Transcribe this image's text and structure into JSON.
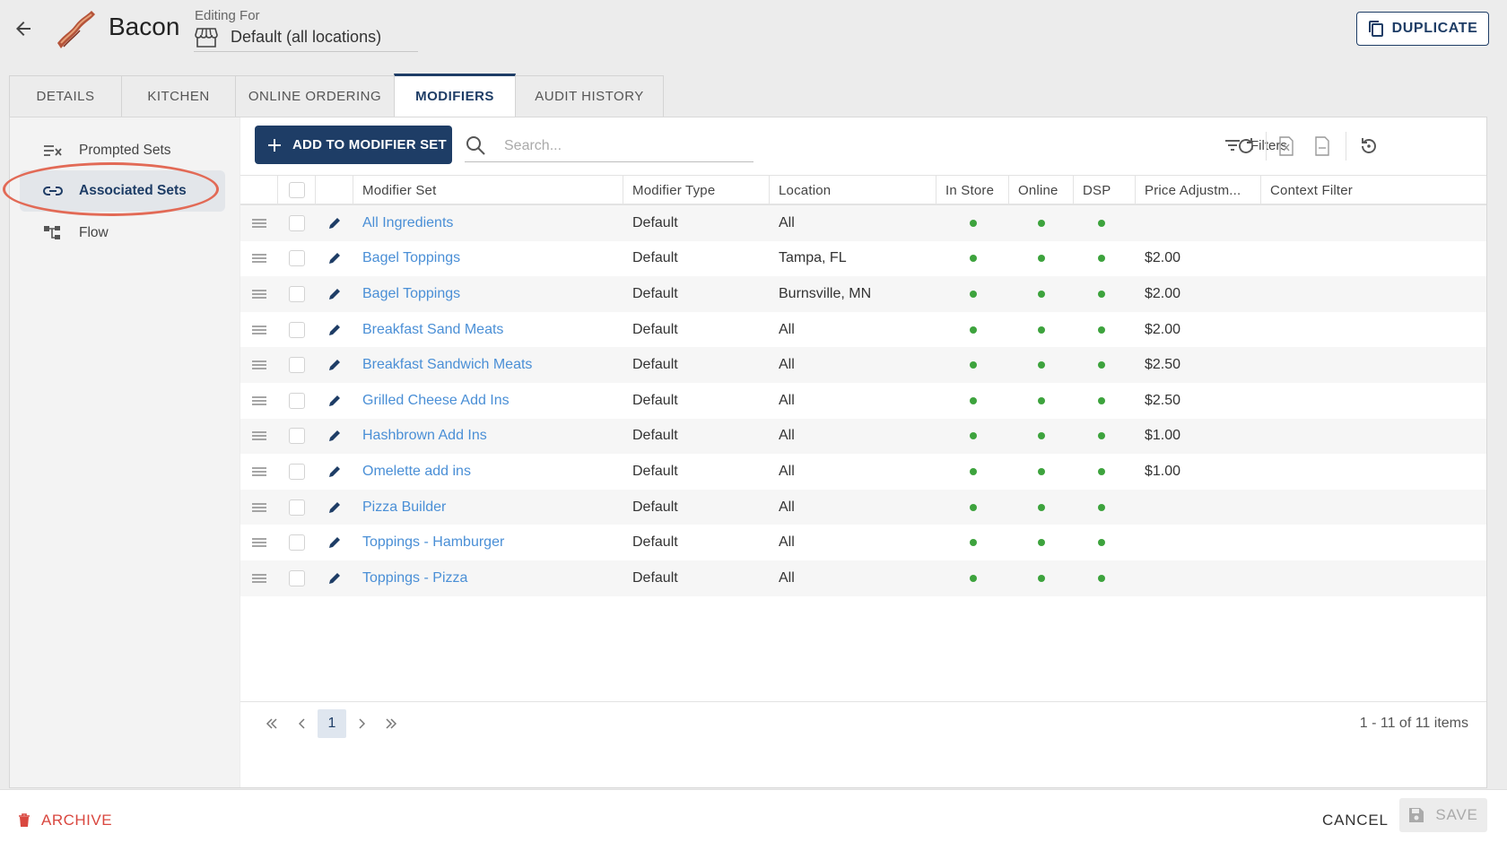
{
  "header": {
    "title": "Bacon",
    "editing_label": "Editing For",
    "editing_value": "Default (all locations)",
    "duplicate_label": "DUPLICATE"
  },
  "tabs": [
    {
      "label": "DETAILS",
      "active": false
    },
    {
      "label": "KITCHEN",
      "active": false
    },
    {
      "label": "ONLINE ORDERING",
      "active": false
    },
    {
      "label": "MODIFIERS",
      "active": true
    },
    {
      "label": "AUDIT HISTORY",
      "active": false
    }
  ],
  "sidebar": {
    "items": [
      {
        "label": "Prompted Sets",
        "icon": "checklist-icon",
        "active": false
      },
      {
        "label": "Associated Sets",
        "icon": "link-icon",
        "active": true
      },
      {
        "label": "Flow",
        "icon": "flow-icon",
        "active": false
      }
    ]
  },
  "toolbar": {
    "add_label": "ADD TO MODIFIER SET",
    "search_placeholder": "Search...",
    "filters_label": "Filters"
  },
  "grid": {
    "columns": [
      "Modifier Set",
      "Modifier Type",
      "Location",
      "In Store",
      "Online",
      "DSP",
      "Price Adjustm...",
      "Context Filter"
    ],
    "rows": [
      {
        "set": "All Ingredients",
        "type": "Default",
        "location": "All",
        "in_store": true,
        "online": true,
        "dsp": true,
        "price": "",
        "context": ""
      },
      {
        "set": "Bagel Toppings",
        "type": "Default",
        "location": "Tampa, FL",
        "in_store": true,
        "online": true,
        "dsp": true,
        "price": "$2.00",
        "context": ""
      },
      {
        "set": "Bagel Toppings",
        "type": "Default",
        "location": "Burnsville, MN",
        "in_store": true,
        "online": true,
        "dsp": true,
        "price": "$2.00",
        "context": ""
      },
      {
        "set": "Breakfast Sand Meats",
        "type": "Default",
        "location": "All",
        "in_store": true,
        "online": true,
        "dsp": true,
        "price": "$2.00",
        "context": ""
      },
      {
        "set": "Breakfast Sandwich Meats",
        "type": "Default",
        "location": "All",
        "in_store": true,
        "online": true,
        "dsp": true,
        "price": "$2.50",
        "context": ""
      },
      {
        "set": "Grilled Cheese Add Ins",
        "type": "Default",
        "location": "All",
        "in_store": true,
        "online": true,
        "dsp": true,
        "price": "$2.50",
        "context": ""
      },
      {
        "set": "Hashbrown Add Ins",
        "type": "Default",
        "location": "All",
        "in_store": true,
        "online": true,
        "dsp": true,
        "price": "$1.00",
        "context": ""
      },
      {
        "set": "Omelette add ins",
        "type": "Default",
        "location": "All",
        "in_store": true,
        "online": true,
        "dsp": true,
        "price": "$1.00",
        "context": ""
      },
      {
        "set": "Pizza Builder",
        "type": "Default",
        "location": "All",
        "in_store": true,
        "online": true,
        "dsp": true,
        "price": "",
        "context": ""
      },
      {
        "set": "Toppings - Hamburger",
        "type": "Default",
        "location": "All",
        "in_store": true,
        "online": true,
        "dsp": true,
        "price": "",
        "context": ""
      },
      {
        "set": "Toppings - Pizza",
        "type": "Default",
        "location": "All",
        "in_store": true,
        "online": true,
        "dsp": true,
        "price": "",
        "context": ""
      }
    ]
  },
  "pager": {
    "current_page": "1",
    "info": "1 - 11 of 11 items"
  },
  "footer": {
    "archive_label": "ARCHIVE",
    "cancel_label": "CANCEL",
    "save_label": "SAVE"
  },
  "colors": {
    "primary": "#1e3d66",
    "link": "#4a8fd6",
    "status_dot": "#3da33d",
    "danger": "#d9473f",
    "highlight_ring": "#e26a56"
  }
}
